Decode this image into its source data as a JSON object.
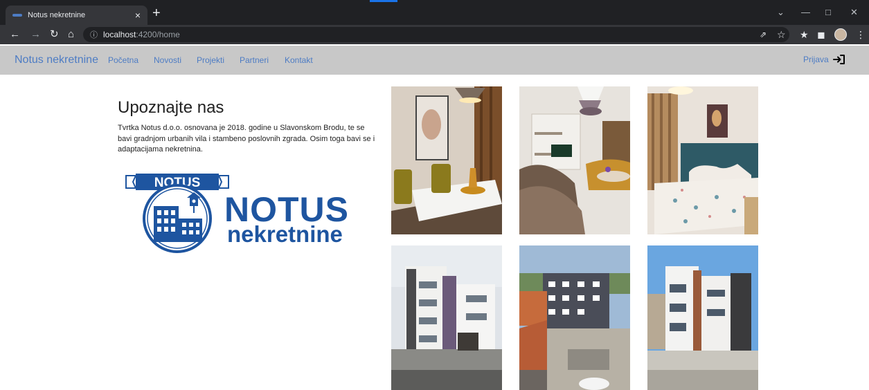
{
  "browser": {
    "tab_title": "Notus nekretnine",
    "tab_close": "×",
    "new_tab": "+",
    "url_host": "localhost",
    "url_path": ":4200/home",
    "icons": [
      "back-icon",
      "forward-icon",
      "reload-icon",
      "home-icon",
      "info-icon",
      "share-icon",
      "star-icon",
      "extensions-icon",
      "sidepanel-icon",
      "profile-icon",
      "menu-icon"
    ]
  },
  "navbar": {
    "brand": "Notus nekretnine",
    "links": [
      "Početna",
      "Novosti",
      "Projekti",
      "Partneri",
      "Kontakt"
    ],
    "login": "Prijava"
  },
  "about": {
    "title": "Upoznajte nas",
    "text": "Tvrtka Notus d.o.o. osnovana je 2018. godine u Slavonskom Brodu, te se bavi gradnjom urbanih vila i stambeno poslovnih zgrada. Osim toga bavi se i adaptacijama nekretnina."
  },
  "logo": {
    "banner": "NOTUS",
    "name": "NOTUS",
    "sub": "nekretnine"
  },
  "colors": {
    "link": "#4d7cc4",
    "navbar_bg": "#c8c8c8",
    "logo_blue": "#1e55a0"
  }
}
